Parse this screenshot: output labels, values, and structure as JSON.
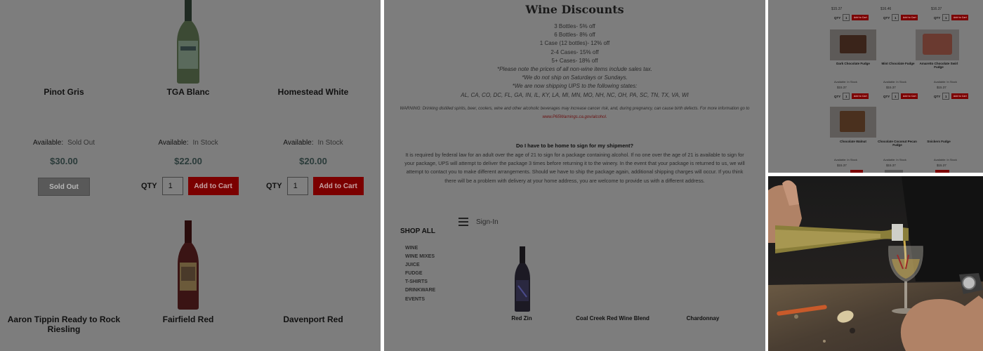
{
  "panel1": {
    "row1": [
      {
        "name": "Pinot Gris",
        "avail_label": "Available:",
        "status": "Sold Out",
        "price": "$30.00",
        "button": "Sold Out"
      },
      {
        "name": "TGA Blanc",
        "avail_label": "Available:",
        "status": "In Stock",
        "price": "$22.00",
        "qty_label": "QTY",
        "qty": "1",
        "button": "Add to Cart"
      },
      {
        "name": "Homestead White",
        "avail_label": "Available:",
        "status": "In Stock",
        "price": "$20.00",
        "qty_label": "QTY",
        "qty": "1",
        "button": "Add to Cart"
      }
    ],
    "row2": [
      {
        "name": "Aaron Tippin Ready to Rock Riesling"
      },
      {
        "name": "Fairfield Red"
      },
      {
        "name": "Davenport Red"
      }
    ]
  },
  "panel2": {
    "title": "Wine Discounts",
    "discounts": [
      "3 Bottles- 5% off",
      "6 Bottles- 8% off",
      "1 Case (12 bottles)- 12% off",
      "2-4 Cases- 15% off",
      "5+ Cases- 18% off"
    ],
    "notes": [
      "*Please note the prices of all non-wine items include sales tax.",
      "*We do not ship on Saturdays or Sundays.",
      "*We are now shipping UPS to the following states:",
      "AL, CA, CO, DC, FL, GA, IN, IL, KY, LA, MI, MN, MO, NH, NC, OH, PA, SC, TN, TX, VA, WI"
    ],
    "warning": "WARNING: Drinking distilled spirits, beer, coolers, wine and other alcoholic beverages may increase cancer risk, and, during pregnancy, can cause birth defects. For more information go to",
    "warning_link": "www.P65Warnings.ca.gov/alcohol.",
    "faq_q": "Do I have to be home to sign for my shipment?",
    "faq_lines": [
      "It is required by federal law for an adult over the age of 21 to sign for a package containing alcohol. If no one over the age of 21 is available to sign for",
      "your package, UPS will attempt to deliver the package 3 times before returning it to the winery. In the event that your package is returned to us, we will",
      "attempt to contact you to make different arrangements. Should we have to ship the package again, additional shipping charges will occur. If you think",
      "there will be a problem with delivery at your home address, you are welcome to provide us with a different address."
    ],
    "shop_all": "SHOP ALL",
    "signin": "Sign-In",
    "categories": [
      "WINE",
      "WINE MIXES",
      "JUICE",
      "FUDGE",
      "T-SHIRTS",
      "DRINKWARE",
      "EVENTS"
    ],
    "products": [
      "Red Zin",
      "Coal Creek Red Wine Blend",
      "Chardonnay"
    ]
  },
  "panel3": {
    "prices_top": [
      "$15.37",
      "$16.46",
      "$16.37"
    ],
    "fudge_row1": [
      "Dark Chocolate Fudge",
      "Mint Chocolate Fudge",
      "Amaretto Chocolate Swirl Fudge"
    ],
    "fudge_row2": [
      "Chocolate Walnut",
      "Chocolate Coconut Pecan Fudge",
      "Snickers Fudge"
    ],
    "avail": "Available:",
    "in_stock": "In Stock",
    "price": "$15.37",
    "qty_label": "QTY",
    "qty": "1",
    "add_to_cart": "Add to Cart"
  },
  "colors": {
    "overlay": "#7d7d7d",
    "cart_red": "#7b0000",
    "sold_gray": "#595959"
  }
}
